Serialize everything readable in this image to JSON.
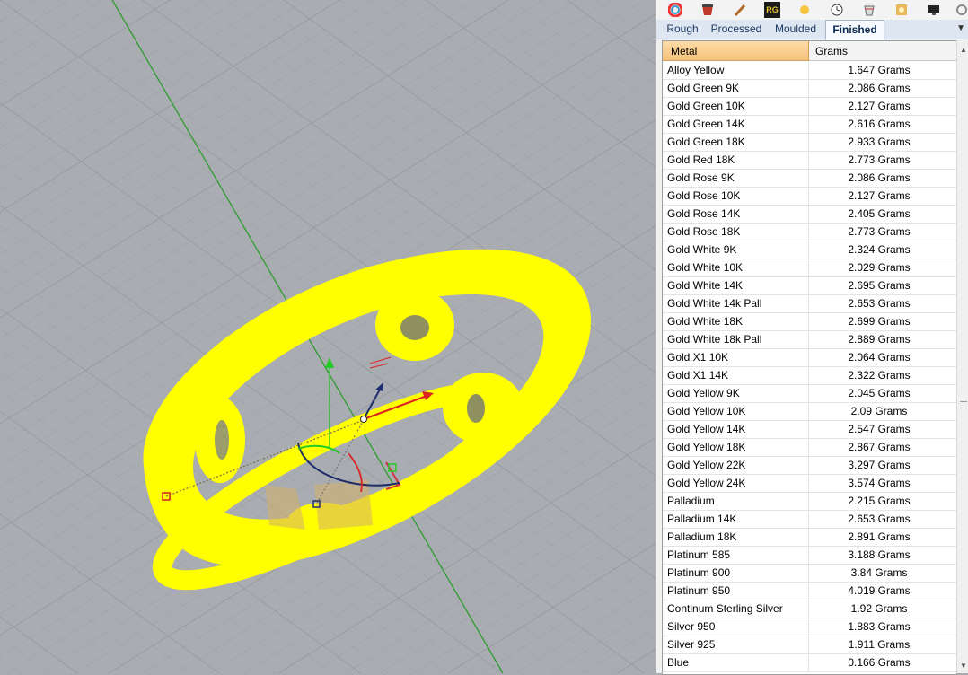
{
  "toolbar": {
    "icons": [
      "color-wheel-icon",
      "material-icon",
      "brush-icon",
      "rg-icon",
      "sun-icon",
      "clock-icon",
      "bucket-icon",
      "render-icon",
      "monitor-icon",
      "settings-icon"
    ],
    "rg_label": "RG"
  },
  "tabs": [
    {
      "label": "Rough",
      "active": false
    },
    {
      "label": "Processed",
      "active": false
    },
    {
      "label": "Moulded",
      "active": false
    },
    {
      "label": "Finished",
      "active": true
    }
  ],
  "table": {
    "headers": {
      "metal": "Metal",
      "grams": "Grams"
    },
    "rows": [
      {
        "metal": "Alloy Yellow",
        "grams": "1.647 Grams"
      },
      {
        "metal": "Gold Green 9K",
        "grams": "2.086 Grams"
      },
      {
        "metal": "Gold Green 10K",
        "grams": "2.127 Grams"
      },
      {
        "metal": "Gold Green 14K",
        "grams": "2.616 Grams"
      },
      {
        "metal": "Gold Green 18K",
        "grams": "2.933 Grams"
      },
      {
        "metal": "Gold Red 18K",
        "grams": "2.773 Grams"
      },
      {
        "metal": "Gold Rose 9K",
        "grams": "2.086 Grams"
      },
      {
        "metal": "Gold Rose 10K",
        "grams": "2.127 Grams"
      },
      {
        "metal": "Gold Rose 14K",
        "grams": "2.405 Grams"
      },
      {
        "metal": "Gold Rose 18K",
        "grams": "2.773 Grams"
      },
      {
        "metal": "Gold White 9K",
        "grams": "2.324 Grams"
      },
      {
        "metal": "Gold White 10K",
        "grams": "2.029 Grams"
      },
      {
        "metal": "Gold White 14K",
        "grams": "2.695 Grams"
      },
      {
        "metal": "Gold White 14k Pall",
        "grams": "2.653 Grams"
      },
      {
        "metal": "Gold White 18K",
        "grams": "2.699 Grams"
      },
      {
        "metal": "Gold White 18k Pall",
        "grams": "2.889 Grams"
      },
      {
        "metal": "Gold X1 10K",
        "grams": "2.064 Grams"
      },
      {
        "metal": "Gold X1 14K",
        "grams": "2.322 Grams"
      },
      {
        "metal": "Gold Yellow 9K",
        "grams": "2.045 Grams"
      },
      {
        "metal": "Gold Yellow 10K",
        "grams": "2.09 Grams"
      },
      {
        "metal": "Gold Yellow 14K",
        "grams": "2.547 Grams"
      },
      {
        "metal": "Gold Yellow 18K",
        "grams": "2.867 Grams"
      },
      {
        "metal": "Gold Yellow 22K",
        "grams": "3.297 Grams"
      },
      {
        "metal": "Gold Yellow 24K",
        "grams": "3.574 Grams"
      },
      {
        "metal": "Palladium",
        "grams": "2.215 Grams"
      },
      {
        "metal": "Palladium 14K",
        "grams": "2.653 Grams"
      },
      {
        "metal": "Palladium 18K",
        "grams": "2.891 Grams"
      },
      {
        "metal": "Platinum 585",
        "grams": "3.188 Grams"
      },
      {
        "metal": "Platinum 900",
        "grams": "3.84 Grams"
      },
      {
        "metal": "Platinum 950",
        "grams": "4.019 Grams"
      },
      {
        "metal": "Continum Sterling Silver",
        "grams": "1.92 Grams"
      },
      {
        "metal": "Silver 950",
        "grams": "1.883 Grams"
      },
      {
        "metal": "Silver 925",
        "grams": "1.911 Grams"
      },
      {
        "metal": "Blue",
        "grams": "0.166 Grams"
      }
    ]
  },
  "colors": {
    "selection_yellow": "#ffff00",
    "viewport_bg": "#a9adb2",
    "header_orange": "#f6c27a"
  }
}
